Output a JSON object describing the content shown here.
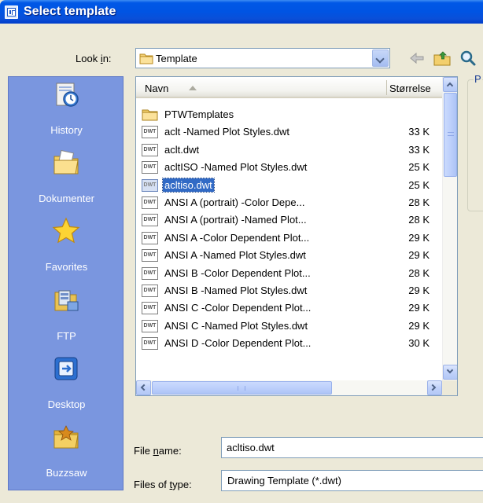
{
  "window": {
    "title": "Select template"
  },
  "lookin": {
    "label_pre": "Look ",
    "label_ul": "i",
    "label_post": "n:",
    "value": "Template"
  },
  "toolbar": {
    "icons": [
      "back-arrow-icon",
      "up-folder-icon",
      "search-icon"
    ]
  },
  "places": [
    {
      "label": "History",
      "icon": "history-icon"
    },
    {
      "label": "Dokumenter",
      "icon": "documents-folder-icon"
    },
    {
      "label": "Favorites",
      "icon": "favorites-star-icon"
    },
    {
      "label": "FTP",
      "icon": "ftp-icon"
    },
    {
      "label": "Desktop",
      "icon": "desktop-icon"
    },
    {
      "label": "Buzzsaw",
      "icon": "buzzsaw-icon"
    }
  ],
  "filelist": {
    "columns": {
      "name": "Navn",
      "size": "Størrelse"
    },
    "files": [
      {
        "name": "PTWTemplates",
        "size": "",
        "type": "folder"
      },
      {
        "name": "aclt -Named Plot Styles.dwt",
        "size": "33 K",
        "type": "dwt"
      },
      {
        "name": "aclt.dwt",
        "size": "33 K",
        "type": "dwt"
      },
      {
        "name": "acltISO -Named Plot Styles.dwt",
        "size": "25 K",
        "type": "dwt"
      },
      {
        "name": "acltiso.dwt",
        "size": "25 K",
        "type": "dwt"
      },
      {
        "name": "ANSI A (portrait) -Color Depe...",
        "size": "28 K",
        "type": "dwt"
      },
      {
        "name": "ANSI A (portrait) -Named Plot...",
        "size": "28 K",
        "type": "dwt"
      },
      {
        "name": "ANSI A -Color Dependent Plot...",
        "size": "29 K",
        "type": "dwt"
      },
      {
        "name": "ANSI A -Named Plot Styles.dwt",
        "size": "29 K",
        "type": "dwt"
      },
      {
        "name": "ANSI B -Color Dependent Plot...",
        "size": "28 K",
        "type": "dwt"
      },
      {
        "name": "ANSI B -Named Plot Styles.dwt",
        "size": "29 K",
        "type": "dwt"
      },
      {
        "name": "ANSI C -Color Dependent Plot...",
        "size": "29 K",
        "type": "dwt"
      },
      {
        "name": "ANSI C -Named Plot Styles.dwt",
        "size": "29 K",
        "type": "dwt"
      },
      {
        "name": "ANSI D -Color Dependent Plot...",
        "size": "30 K",
        "type": "dwt"
      }
    ],
    "selected": "acltiso.dwt",
    "file_icon_text": "DWT"
  },
  "preview": {
    "label": "P"
  },
  "filename": {
    "label_pre": "File ",
    "label_ul": "n",
    "label_post": "ame:",
    "value": "acltiso.dwt"
  },
  "filetype": {
    "label_pre": "Files of ",
    "label_ul": "t",
    "label_post": "ype:",
    "value": "Drawing Template (*.dwt)"
  },
  "colors": {
    "titlebar": "#0054e3",
    "places_bg": "#7a96df",
    "selection": "#316ac5",
    "dialog_bg": "#ece9d8"
  }
}
